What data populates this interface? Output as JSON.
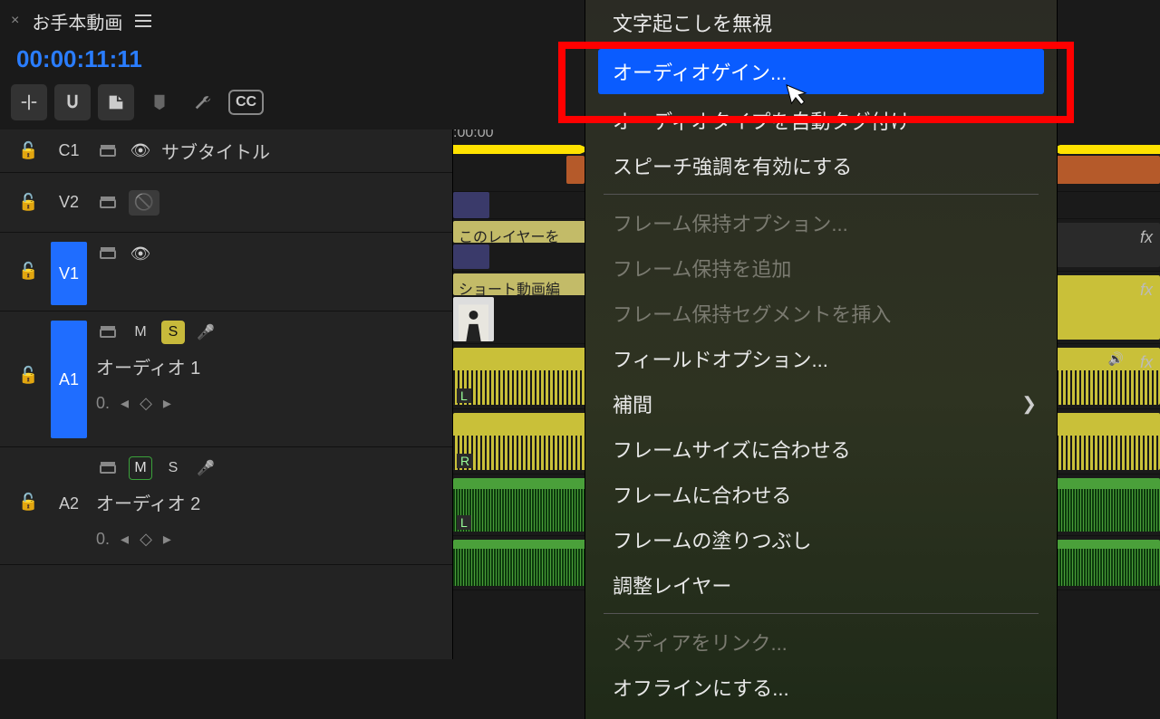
{
  "header": {
    "sequence_name": "お手本動画",
    "timecode": "00:00:11:11"
  },
  "toolbar": {
    "insert_overwrite": "insert",
    "snap": "snap",
    "linked_selection": "linked-selection",
    "marker": "marker",
    "wrench": "settings",
    "cc": "CC"
  },
  "timeline": {
    "ruler_start": ":00:00"
  },
  "tracks": {
    "c1": {
      "id": "C1",
      "label": "サブタイトル"
    },
    "v2": {
      "id": "V2"
    },
    "v1": {
      "id": "V1"
    },
    "a1": {
      "id": "A1",
      "label": "オーディオ 1",
      "mute": "M",
      "solo": "S",
      "keyframe": "0."
    },
    "a2": {
      "id": "A2",
      "label": "オーディオ 2",
      "mute": "M",
      "solo": "S",
      "keyframe": "0."
    }
  },
  "clips": {
    "v2_label": "このレイヤーを",
    "v1_label": "ショート動画編",
    "a1_L": "L",
    "a1_R": "R",
    "a2_L": "L",
    "fx": "fx"
  },
  "context_menu": {
    "items": [
      {
        "label": "文字起こしを無視",
        "type": "item"
      },
      {
        "label": "オーディオゲイン...",
        "type": "highlight"
      },
      {
        "type": "hidden"
      },
      {
        "label": "オーディオタイプを自動タグ付け",
        "type": "item"
      },
      {
        "label": "スピーチ強調を有効にする",
        "type": "item"
      },
      {
        "type": "sep"
      },
      {
        "label": "フレーム保持オプション...",
        "type": "disabled"
      },
      {
        "label": "フレーム保持を追加",
        "type": "disabled"
      },
      {
        "label": "フレーム保持セグメントを挿入",
        "type": "disabled"
      },
      {
        "label": "フィールドオプション...",
        "type": "item"
      },
      {
        "label": "補間",
        "type": "submenu"
      },
      {
        "label": "フレームサイズに合わせる",
        "type": "item"
      },
      {
        "label": "フレームに合わせる",
        "type": "item"
      },
      {
        "label": "フレームの塗りつぶし",
        "type": "item"
      },
      {
        "label": "調整レイヤー",
        "type": "item"
      },
      {
        "type": "sep"
      },
      {
        "label": "メディアをリンク...",
        "type": "disabled"
      },
      {
        "label": "オフラインにする...",
        "type": "item"
      }
    ]
  }
}
